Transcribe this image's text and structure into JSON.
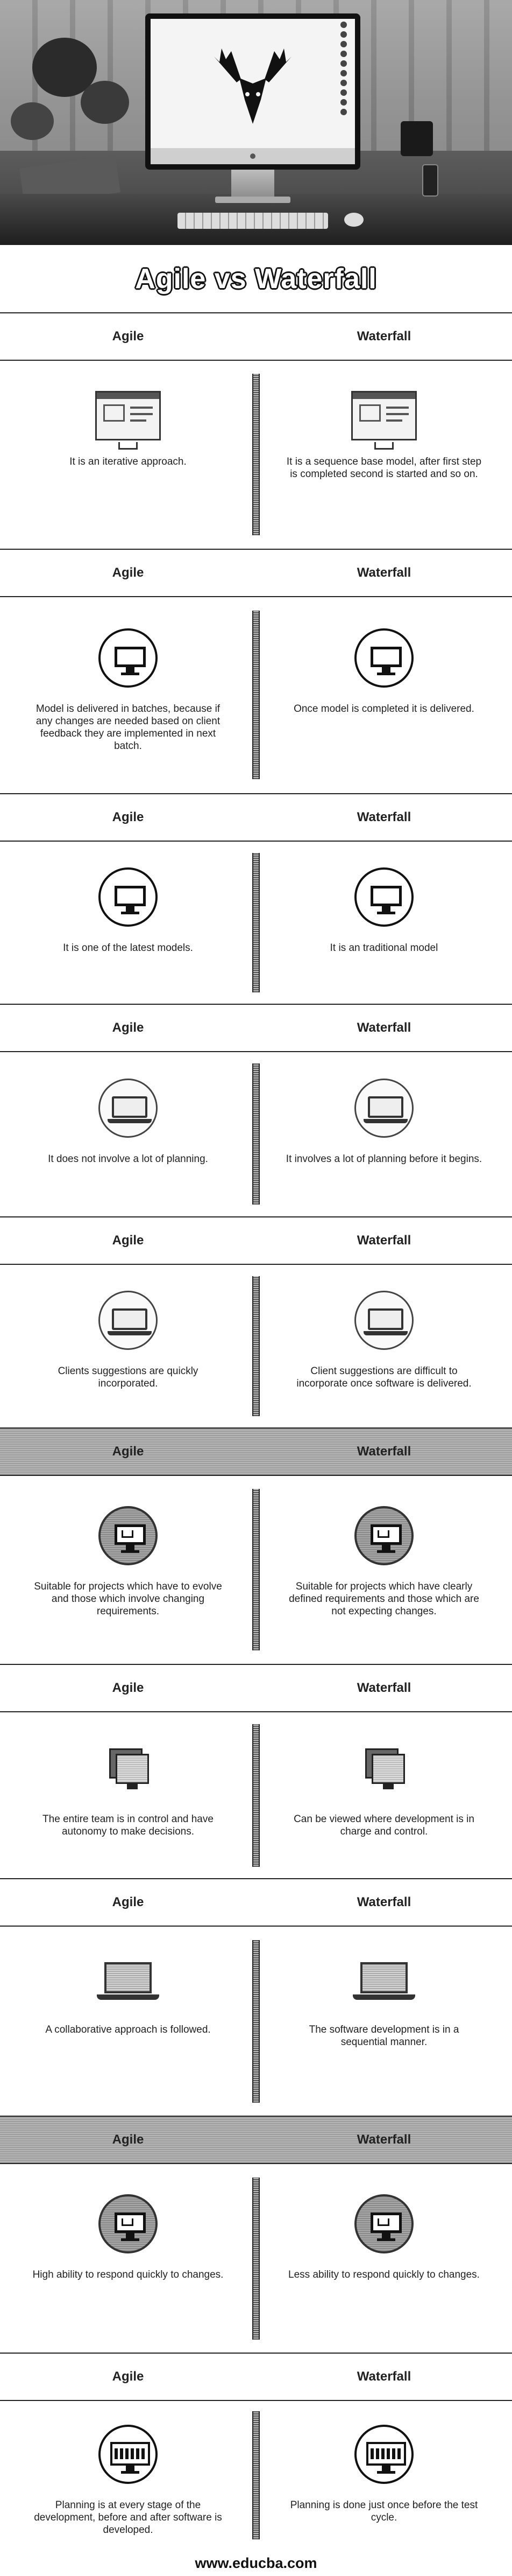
{
  "title": "Agile vs Waterfall",
  "columns": {
    "left": "Agile",
    "right": "Waterfall"
  },
  "rows": [
    {
      "left": "It is an iterative approach.",
      "right": "It is a sequence base model, after first step is completed second is started and so on.",
      "icon": "monitor-window-icon"
    },
    {
      "left": "Model is delivered in batches, because if any changes are needed based on client feedback they are implemented in next batch.",
      "right": "Once model is completed it is delivered.",
      "icon": "circle-monitor-icon"
    },
    {
      "left": "It is one of the latest models.",
      "right": "It is an traditional model",
      "icon": "circle-monitor-icon"
    },
    {
      "left": "It does not involve a lot of planning.",
      "right": "It involves a lot of planning before it begins.",
      "icon": "laptop-icon"
    },
    {
      "left": "Clients suggestions are quickly incorporated.",
      "right": "Client suggestions are difficult to incorporate once software is delivered.",
      "icon": "laptop-icon"
    },
    {
      "left": "Suitable for projects which have to evolve and those which involve changing requirements.",
      "right": "Suitable for projects which have clearly defined requirements and those which are not expecting changes.",
      "icon": "grey-circle-monitor-icon"
    },
    {
      "left": "The entire team is in control and have autonomy to make decisions.",
      "right": "Can be viewed where development is in charge and control.",
      "icon": "stacked-monitor-icon"
    },
    {
      "left": "A collaborative approach is followed.",
      "right": "The software development is in a sequential manner.",
      "icon": "plain-laptop-icon"
    },
    {
      "left": "High ability to respond quickly to changes.",
      "right": "Less ability to respond quickly to changes.",
      "icon": "grey-circle-monitor-icon"
    },
    {
      "left": "Planning is at every stage of the development, before and after software is developed.",
      "right": "Planning is done just once before the test cycle.",
      "icon": "busy-monitor-icon"
    }
  ],
  "footer": "www.educba.com"
}
